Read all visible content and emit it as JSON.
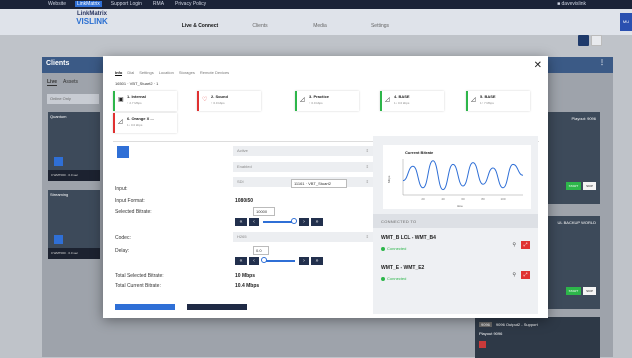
{
  "topbar": {
    "links": [
      "Website",
      "LinkMatrix",
      "Support Login",
      "RMA",
      "Privacy Policy"
    ],
    "active_link": "LinkMatrix",
    "user": "davevislink"
  },
  "logo": {
    "line1": "LinkMatrix",
    "line2": "VISLINK"
  },
  "nav": {
    "tabs": [
      "Live & Connect",
      "Clients",
      "Media",
      "Settings"
    ],
    "active": "Live & Connect"
  },
  "side_tab": "MU",
  "background": {
    "panel_title": "Clients",
    "tabs": [
      "Live",
      "Assets"
    ],
    "filter": "Online Only",
    "tiles": [
      {
        "caption": "Quantum",
        "meta": "0 WMT000 · 0.0 sec"
      },
      {
        "caption": "Streaming",
        "meta": "0 WMT000 · 0.0 sec"
      },
      {
        "caption": "Playout",
        "right_caption": "Playout: 9096",
        "chips": [
          "START",
          "SKIP"
        ]
      },
      {
        "caption": "",
        "right_caption": "UL BACKUP WORLD",
        "chips": [
          "START",
          "SKIP"
        ]
      },
      {
        "caption": "9096 Output2 - Support",
        "num": "9096",
        "sub": "Playout 9096"
      }
    ]
  },
  "modal": {
    "tabs": [
      "Info",
      "Dial",
      "Settings",
      "Location",
      "Storages",
      "Remote Devices"
    ],
    "active_tab": "Info",
    "device_id": "16501 · VBT_Stuart2 · 1",
    "inputs": [
      {
        "name": "1. Internal",
        "sub": "↑ 2.7 Mbps",
        "color": "#2db64a",
        "icon": "▣"
      },
      {
        "name": "2. Sound",
        "sub": "↑ 0.0 kbps",
        "color": "#e03131",
        "icon": "♡"
      },
      {
        "name": "3. Practice",
        "sub": "↑ 0.0 kbps",
        "color": "#2db64a",
        "icon": "◿"
      },
      {
        "name": "4. BASE",
        "sub": "1↓ 0.0 kbps",
        "color": "#2db64a",
        "icon": "◿"
      },
      {
        "name": "5. BASE",
        "sub": "1↑ 7 Mbps",
        "color": "#2db64a",
        "icon": "◿"
      },
      {
        "name": "6. Orange X ...",
        "sub": "1↓ 0.0 kbps",
        "color": "#e03131",
        "icon": "◿"
      }
    ],
    "left": {
      "status_select": "Active",
      "mode_select": "Enabled",
      "sdi_select": "SDI",
      "input_label": "Input:",
      "input_value": "11161 · VBT_Stuart2",
      "input_format_label": "Input Format:",
      "input_format_value": "1080i50",
      "selected_bitrate_label": "Selected Bitrate:",
      "selected_bitrate_value": "10000",
      "codec_label": "Codec:",
      "codec_select": "H265",
      "delay_label": "Delay:",
      "delay_value": "0.0",
      "total_selected_label": "Total Selected Bitrate:",
      "total_selected_value": "10 Mbps",
      "total_current_label": "Total Current Bitrate:",
      "total_current_value": "10.4 Mbps"
    },
    "chart_data": {
      "type": "line",
      "title": "Current Bitrate",
      "ylabel": "Mbps",
      "xlabel": "time",
      "x": [
        0,
        10,
        20,
        30,
        40,
        50,
        60,
        70,
        80,
        90,
        100,
        110,
        120
      ],
      "series": [
        {
          "values": [
            9.8,
            10.6,
            9.4,
            10.9,
            9.3,
            10.7,
            9.5,
            10.8,
            9.6,
            10.5,
            9.4,
            10.7,
            10.1
          ]
        }
      ],
      "ylim": [
        9,
        11
      ],
      "xticks": [
        "20",
        "40",
        "60",
        "80",
        "100"
      ]
    },
    "connected_title": "CONNECTED TO",
    "connections": [
      {
        "name": "WMT_B LCL - WMT_B4",
        "status": "Connected"
      },
      {
        "name": "WMT_E - WMT_E2",
        "status": "Connected"
      }
    ]
  }
}
